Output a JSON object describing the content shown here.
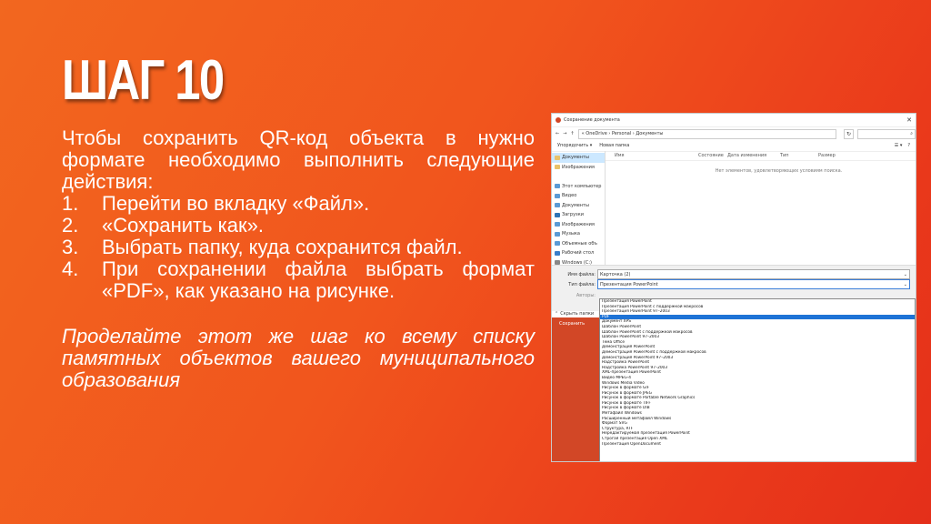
{
  "slide": {
    "title": "ШАГ 10",
    "intro": "Чтобы сохранить  QR-код объекта в нужно формате необходимо выполнить следующие действия:",
    "steps": [
      {
        "num": "1.",
        "text": "Перейти во вкладку «Файл»."
      },
      {
        "num": "2.",
        "text": "«Сохранить как»."
      },
      {
        "num": "3.",
        "text": "Выбрать папку, куда сохранится файл."
      },
      {
        "num": "4.",
        "text": "При сохранении файла выбрать формат «PDF», как указано на рисунке."
      }
    ],
    "note": "Проделайте этот же шаг ко всему списку памятных объектов вашего муниципального образования"
  },
  "dialog": {
    "title": "Сохранение документа",
    "close": "✕",
    "address": "« OneDrive › Personal › Документы",
    "refresh": "↻",
    "search_icon": "⌕",
    "toolbar": {
      "organize": "Упорядочить ▾",
      "new_folder": "Новая папка",
      "view": "☰ ▾",
      "help": "?"
    },
    "sidebar": [
      {
        "label": "Документы",
        "color": "#e8c26a",
        "selected": true
      },
      {
        "label": "Изображения",
        "color": "#e8c26a",
        "selected": false
      },
      {
        "label": "",
        "color": "",
        "selected": false
      },
      {
        "label": "Этот компьютер",
        "color": "#5b9bd5",
        "selected": false
      },
      {
        "label": "Видео",
        "color": "#5b9bd5",
        "selected": false
      },
      {
        "label": "Документы",
        "color": "#5b9bd5",
        "selected": false
      },
      {
        "label": "Загрузки",
        "color": "#2e75b6",
        "selected": false
      },
      {
        "label": "Изображения",
        "color": "#5b9bd5",
        "selected": false
      },
      {
        "label": "Музыка",
        "color": "#5b9bd5",
        "selected": false
      },
      {
        "label": "Объемные объ",
        "color": "#5b9bd5",
        "selected": false
      },
      {
        "label": "Рабочий стол",
        "color": "#3a7ec9",
        "selected": false
      },
      {
        "label": "Windows (C:)",
        "color": "#888888",
        "selected": false
      }
    ],
    "columns": [
      "Имя",
      "Состояние",
      "Дата изменения",
      "Тип",
      "Размер"
    ],
    "empty_message": "Нет элементов, удовлетворяющих условиям поиска.",
    "filename_label": "Имя файла:",
    "filename_value": "Карточка (2)",
    "filetype_label": "Тип файла:",
    "filetype_value": "Презентация PowerPoint",
    "authors_label": "Авторы:",
    "hide_folders": "Скрыть папки",
    "side_action": "Сохранить",
    "types": [
      "Презентация PowerPoint",
      "Презентация PowerPoint с поддержкой макросов",
      "Презентация PowerPoint 97–2003",
      "PDF",
      "Документ XPS",
      "Шаблон PowerPoint",
      "Шаблон PowerPoint с поддержкой макросов",
      "Шаблон PowerPoint 97–2003",
      "Тема Office",
      "Демонстрация PowerPoint",
      "Демонстрация PowerPoint с поддержкой макросов",
      "Демонстрация PowerPoint 97–2003",
      "Надстройка PowerPoint",
      "Надстройка PowerPoint 97–2003",
      "XML-презентация PowerPoint",
      "Видео MPEG-4",
      "Windows Media Video",
      "Рисунок в формате GIF",
      "Рисунок в формате JPEG",
      "Рисунок в формате Portable Network Graphics",
      "Рисунок в формате TIFF",
      "Рисунок в формате DIB",
      "Метафайл Windows",
      "Расширенный метафайл Windows",
      "Формат SVG",
      "Структура, RTF",
      "Нередактируемая презентация PowerPoint",
      "Строгая презентация Open XML",
      "Презентация OpenDocument"
    ],
    "highlighted_index": 3
  }
}
